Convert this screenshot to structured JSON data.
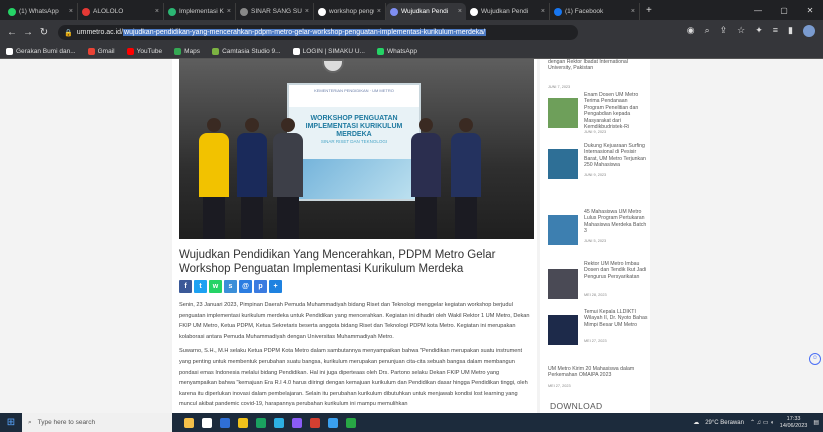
{
  "browser": {
    "tabs": [
      {
        "title": "(1) WhatsApp",
        "color": "#25d366"
      },
      {
        "title": "ALOLOLO",
        "color": "#e53935"
      },
      {
        "title": "Implementasi K",
        "color": "#2bb673"
      },
      {
        "title": "SINAR SANG SU",
        "color": "#888888"
      },
      {
        "title": "workshop pengu",
        "color": "#ffffff"
      },
      {
        "title": "Wujudkan Pendi",
        "color": "#7f8ef2",
        "active": true
      },
      {
        "title": "Wujudkan Pendi",
        "color": "#ffffff"
      },
      {
        "title": "(1) Facebook",
        "color": "#1877f2"
      }
    ],
    "url_prefix": "ummetro.ac.id/",
    "url_path": "wujudkan-pendidikan-yang-mencerahkan-pdpm-metro-gelar-workshop-penguatan-implementasi-kurikulum-merdeka/",
    "bookmarks": [
      {
        "label": "Gerakan Bumi dan...",
        "color": "#ffffff"
      },
      {
        "label": "Gmail",
        "color": "#ea4335"
      },
      {
        "label": "YouTube",
        "color": "#ff0000"
      },
      {
        "label": "Maps",
        "color": "#34a853"
      },
      {
        "label": "Camtasia Studio 9...",
        "color": "#7cb342"
      },
      {
        "label": "LOGIN | SIMAKU U...",
        "color": "#ffffff"
      },
      {
        "label": "WhatsApp",
        "color": "#25d366"
      }
    ]
  },
  "article": {
    "screen_header": "KEMENTERIAN PENDIDIKAN · UM METRO",
    "screen_title": "WORKSHOP PENGUATAN IMPLEMENTASI KURIKULUM MERDEKA",
    "screen_subtitle": "SINAR RISET DAN TEKNOLOGI",
    "title": "Wujudkan Pendidikan Yang Mencerahkan, PDPM Metro Gelar Workshop Penguatan Implementasi Kurikulum Merdeka",
    "share": [
      {
        "icon": "facebook-icon",
        "glyph": "f",
        "color": "#3b5998"
      },
      {
        "icon": "twitter-icon",
        "glyph": "t",
        "color": "#1da1f2"
      },
      {
        "icon": "whatsapp-icon",
        "glyph": "w",
        "color": "#25d366"
      },
      {
        "icon": "share-icon",
        "glyph": "s",
        "color": "#3b8fd8"
      },
      {
        "icon": "email-icon",
        "glyph": "@",
        "color": "#2b7de1"
      },
      {
        "icon": "print-icon",
        "glyph": "p",
        "color": "#3b7be0"
      },
      {
        "icon": "plus-icon",
        "glyph": "+",
        "color": "#1e82e0"
      }
    ],
    "paragraphs": [
      "Senin, 23 Januari 2023, Pimpinan Daerah Pemuda Muhammadiyah bidang Riset dan Teknologi menggelar kegiatan workshop berjudul penguatan implementasi kurikulum merdeka untuk Pendidikan yang mencerahkan. Kegiatan ini dihadiri oleh Wakil Rektor 1 UM Metro, Dekan FKIP UM Metro, Ketua PDPM, Ketua Sekretaris beserta anggota bidang Riset dan Teknologi PDPM kota Metro. Kegiatan ini merupakan kolaborasi antara Pemuda Muhammadiyah dengan Universitas Muhammadiyah Metro.",
      "Suwarno, S.H., M.H selaku Ketua PDPM Kota Metro dalam sambutannya menyampaikan bahwa \"Pendidikan merupakan suatu instrument yang penting untuk membentuk perubahan suatu bangsa, kurikulum merupakan penunjuan cita-cita sebuah bangsa dalam membangun pondasi emas Indonesia melalui bidang Pendidikan. Hal ini juga diperteaas oleh Drs. Partono selaku Dekan FKIP UM Metro yang menyampaikan bahwa \"kemajuan Era R.I 4.0 harus diiringi dengan kemajuan kurikulum dan Pendidikan dasar hingga Pendidikan tinggi, oleh karena itu diperlukan inovasi dalam pembelajaran. Selain itu perubahan kurikulum dibutuhkan untuk menjawab kondisi lost learning yang muncul akibat pandemic covid-19, harapannya perubahan kurikulum ini mampu memulihkan"
    ]
  },
  "sidebar": {
    "items": [
      {
        "text": "dengan Rektor Ibadat International University, Pakistan",
        "date": "JUNI 7, 2023",
        "color": "#ffffff"
      },
      {
        "text": "Enam Dosen UM Metro Terima Pendanaan Program Penelitian dan Pengabdian kepada Masyarakat dari Kemdikbudristek-Ri",
        "date": "JUNI 9, 2023",
        "color": "#6e9f5a"
      },
      {
        "text": "Dukung Kejuaraan Surfing Internasional di Pesisir Barat, UM Metro Terjunkan 250 Mahasiswa",
        "date": "JUNI 9, 2023",
        "color": "#2e6f96"
      },
      {
        "text": "45 Mahasiswa UM Metro Lulus Program Pertukaran Mahasiswa Merdeka Batch 3",
        "date": "JUNI 5, 2023",
        "color": "#3d7fb0"
      },
      {
        "text": "Rektor UM Metro Imbau Dosen dan Tendik Ikut Jadi Pengurus Persyarikatan",
        "date": "MEI 28, 2023",
        "color": "#4a4a55"
      },
      {
        "text": "Temui Kepala LLDIKTI Wilayah II, Dr. Nyoto Bahas Mimpi Besar UM Metro",
        "date": "MEI 27, 2023",
        "color": "#1d2a4a"
      },
      {
        "text": "UM Metro Kirim 20 Mahasiswa dalam Perkemahan OMAIPA 2023",
        "date": "MEI 27, 2023",
        "color": "#ffffff"
      }
    ],
    "download_label": "DOWNLOAD"
  },
  "taskbar": {
    "search_placeholder": "Type here to search",
    "weather": "29°C Berawan",
    "time": "17:33",
    "date": "14/06/2023",
    "apps": [
      "#f5c04a",
      "#ffffff",
      "#2f6fd6",
      "#f1c21b",
      "#1aa260",
      "#2db0e3",
      "#8a5cf5",
      "#d23f31",
      "#3aa0f0",
      "#28a745"
    ]
  }
}
